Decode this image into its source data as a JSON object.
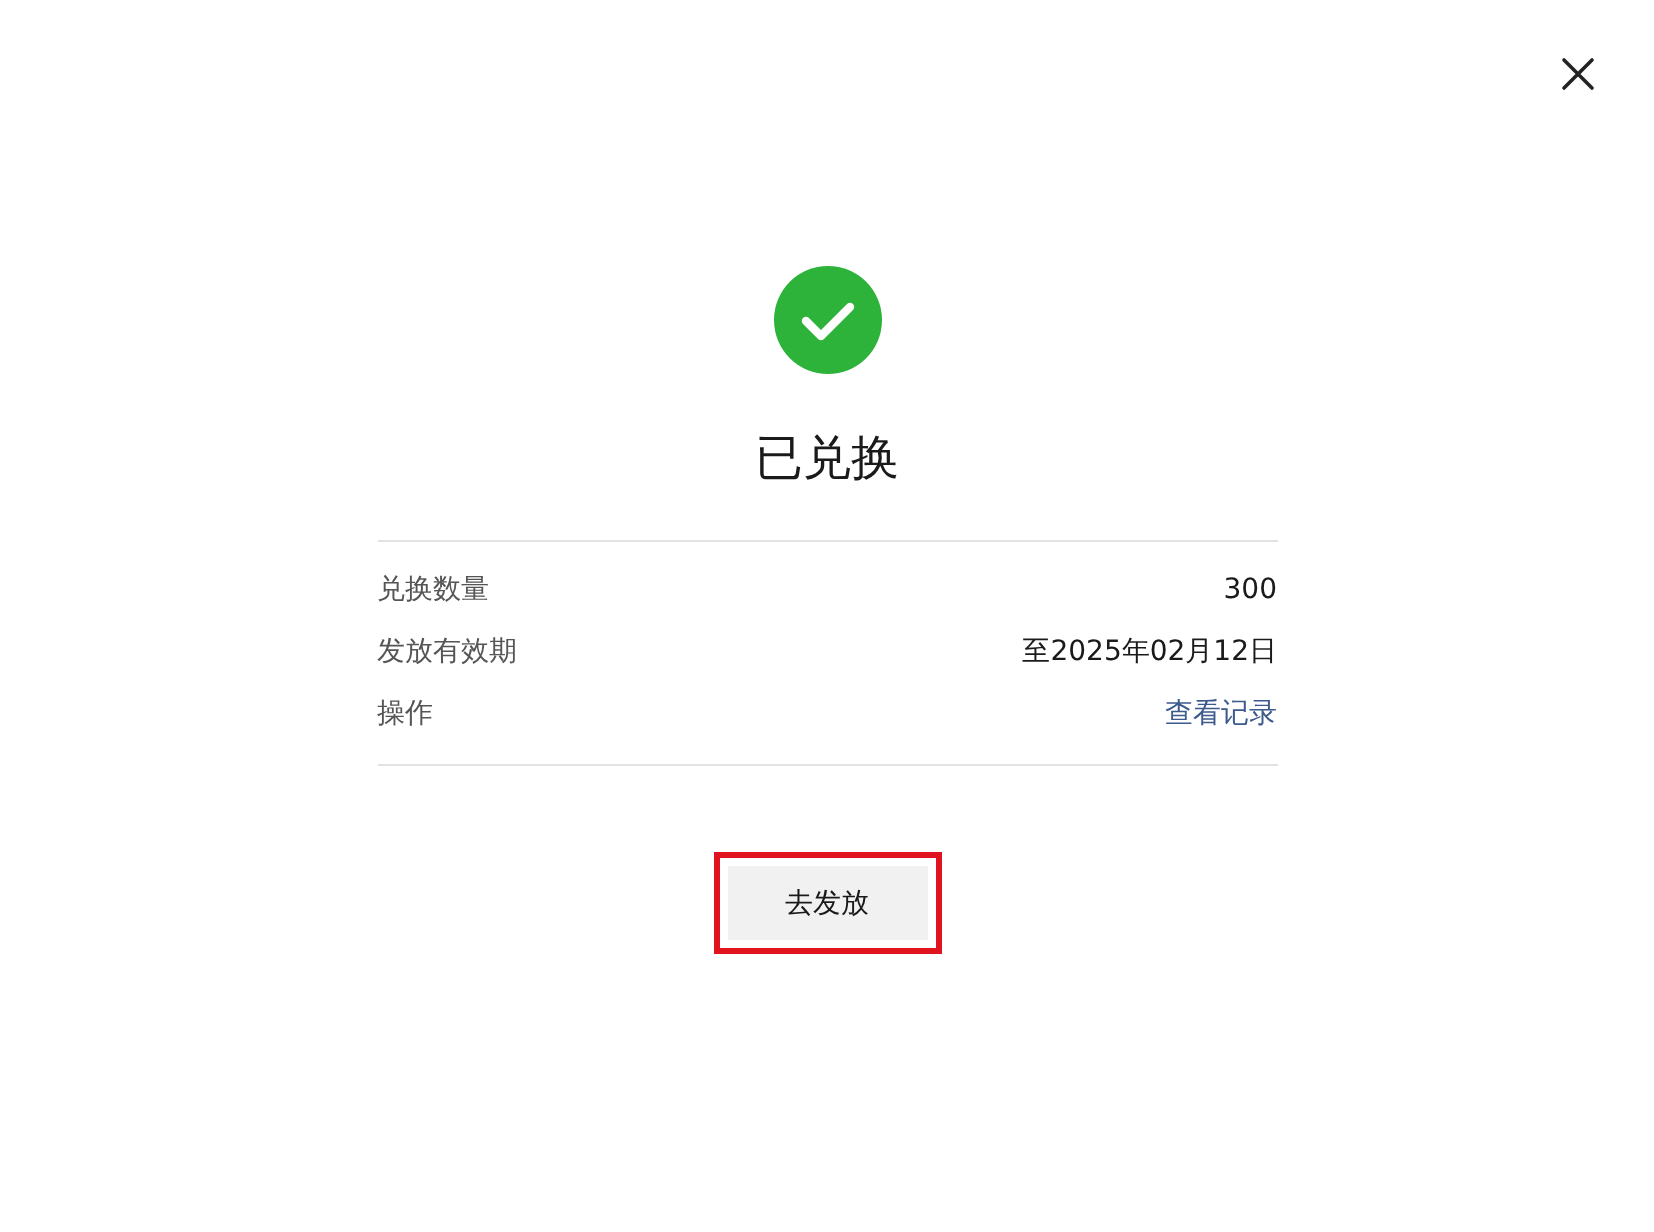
{
  "dialog": {
    "success": true,
    "title": "已兑换",
    "details": [
      {
        "label": "兑换数量",
        "value": "300",
        "kind": "text"
      },
      {
        "label": "发放有效期",
        "value": "至2025年02月12日",
        "kind": "text"
      },
      {
        "label": "操作",
        "value": "查看记录",
        "kind": "link"
      }
    ],
    "button": {
      "label": "去发放",
      "highlighted": true
    }
  }
}
